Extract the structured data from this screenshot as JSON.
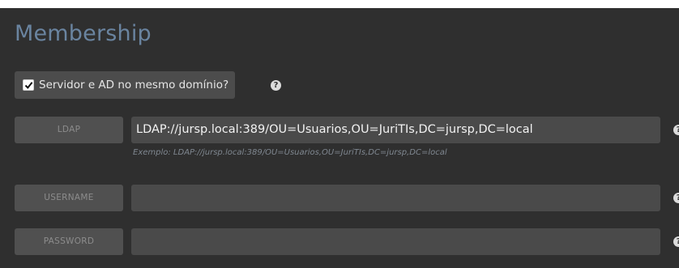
{
  "section": {
    "title": "Membership"
  },
  "same_domain": {
    "checked": true,
    "label": "Servidor e AD no mesmo domínio?",
    "help_icon": "question-circle-icon"
  },
  "fields": {
    "ldap": {
      "label": "LDAP",
      "value": "LDAP://jursp.local:389/OU=Usuarios,OU=JuriTIs,DC=jursp,DC=local",
      "hint": "Exemplo: LDAP://jursp.local:389/OU=Usuarios,OU=JuriTIs,DC=jursp,DC=local"
    },
    "username": {
      "label": "USERNAME",
      "value": ""
    },
    "password": {
      "label": "PASSWORD",
      "value": ""
    }
  },
  "icons": {
    "help": "question-circle-icon",
    "check": "checkmark-icon"
  },
  "colors": {
    "panel_background": "#2f2f2f",
    "title": "#6a84a0",
    "input_background": "#4a4a4a",
    "label_background": "#505050"
  }
}
